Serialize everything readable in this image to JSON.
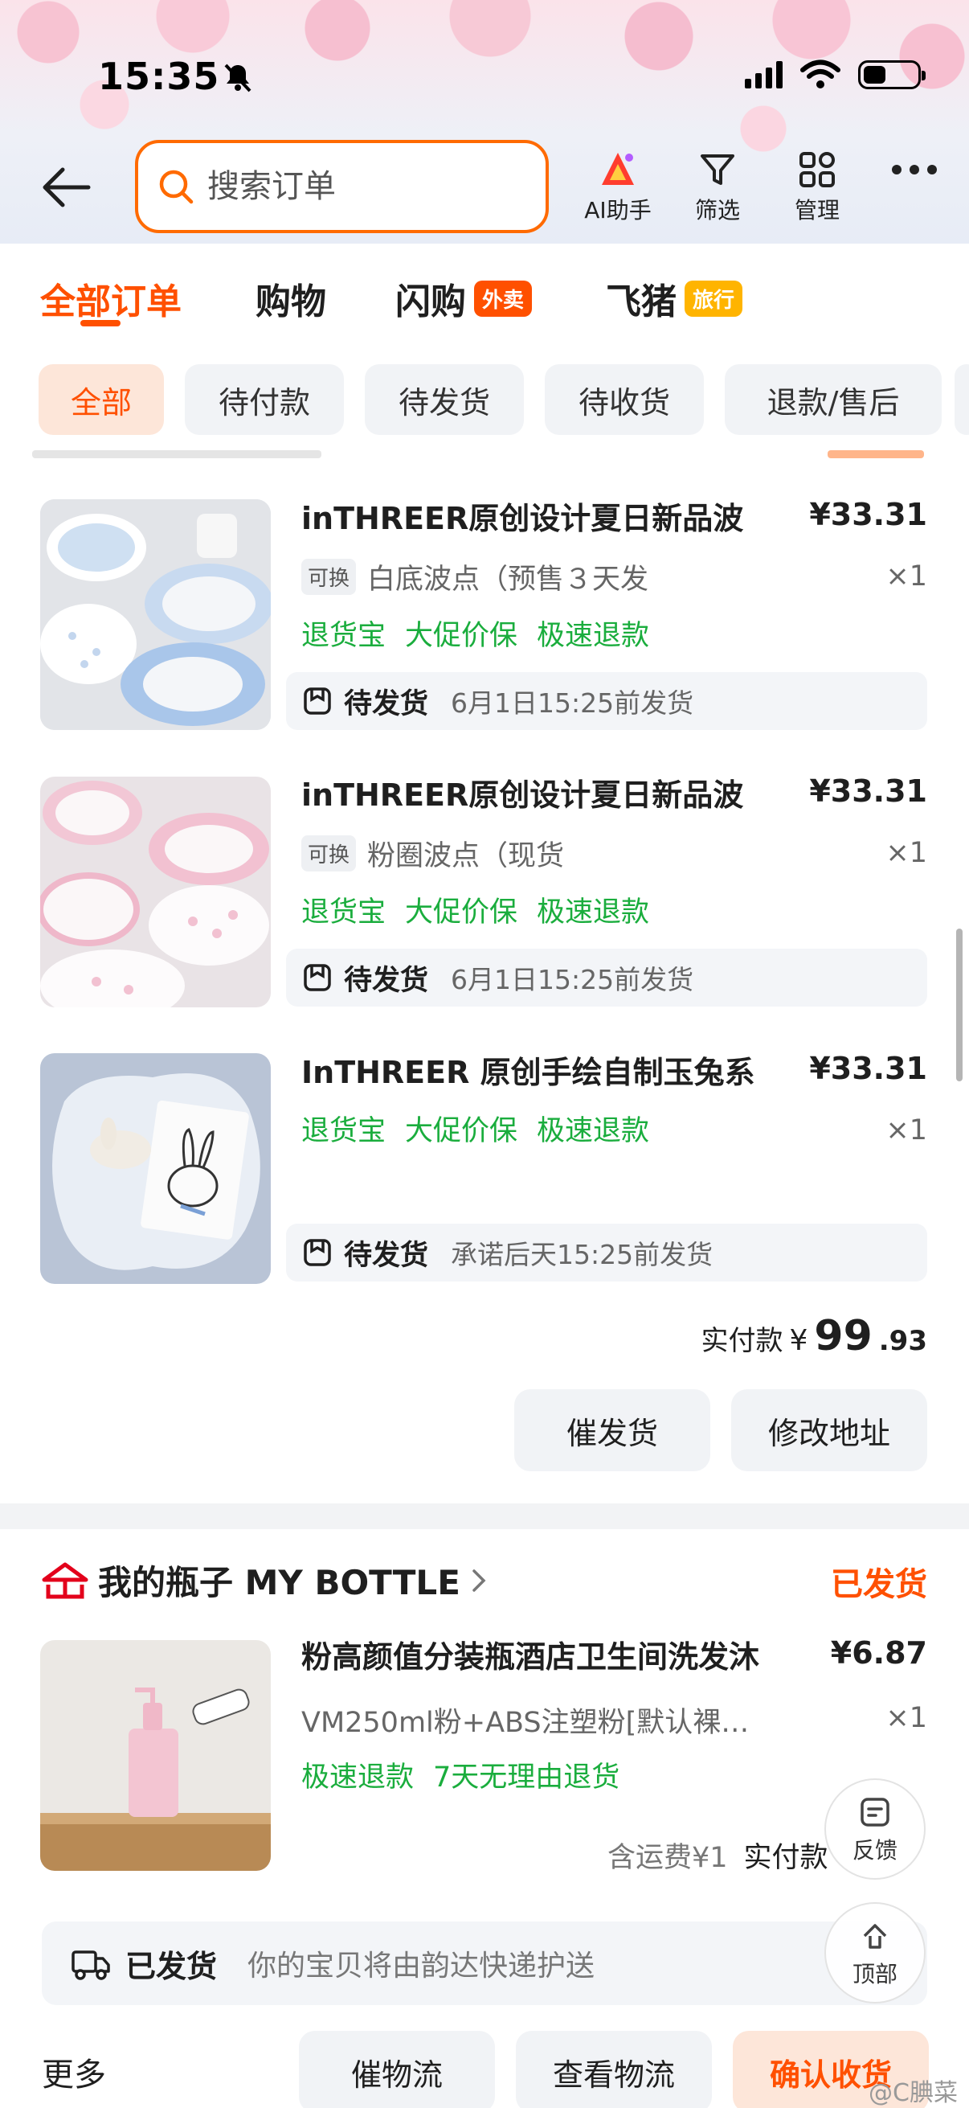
{
  "status_bar": {
    "time": "15:35"
  },
  "header": {
    "search_placeholder": "搜索订单",
    "tools": [
      {
        "label": "AI助手",
        "icon": "ai-assistant-icon"
      },
      {
        "label": "筛选",
        "icon": "filter-icon"
      },
      {
        "label": "管理",
        "icon": "grid-icon"
      }
    ]
  },
  "tabs": [
    {
      "label": "全部订单",
      "active": true
    },
    {
      "label": "购物"
    },
    {
      "label": "闪购",
      "badge": "外卖",
      "badge_color": "#ff5000"
    },
    {
      "label": "飞猪",
      "badge": "旅行",
      "badge_color": "#ffb400"
    }
  ],
  "filters": [
    "全部",
    "待付款",
    "待发货",
    "待收货",
    "退款/售后"
  ],
  "order1": {
    "items": [
      {
        "title": "inTHREER原创设计夏日新品波",
        "price": "¥33.31",
        "swap": "可换",
        "sku": "白底波点（预售３天发",
        "qty": "×1",
        "tags": [
          "退货宝",
          "大促价保",
          "极速退款"
        ],
        "ship_status": "待发货",
        "ship_time": "6月1日15:25前发货"
      },
      {
        "title": "inTHREER原创设计夏日新品波",
        "price": "¥33.31",
        "swap": "可换",
        "sku": "粉圈波点（现货",
        "qty": "×1",
        "tags": [
          "退货宝",
          "大促价保",
          "极速退款"
        ],
        "ship_status": "待发货",
        "ship_time": "6月1日15:25前发货"
      },
      {
        "title": "InTHREER 原创手绘自制玉兔系",
        "price": "¥33.31",
        "qty": "×1",
        "tags": [
          "退货宝",
          "大促价保",
          "极速退款"
        ],
        "ship_status": "待发货",
        "ship_time": "承诺后天15:25前发货"
      }
    ],
    "paid_label": "实付款",
    "paid_currency": "¥",
    "paid_int": "99",
    "paid_dec": ".93",
    "buttons": [
      "催发货",
      "修改地址"
    ]
  },
  "order2": {
    "shop": "我的瓶子 MY BOTTLE",
    "status": "已发货",
    "item": {
      "title": "粉高颜值分装瓶酒店卫生间洗发沐",
      "price": "¥6.87",
      "sku": "VM250ml粉+ABS注塑粉[默认裸…",
      "qty": "×1",
      "tags": [
        "极速退款",
        "7天无理由退货"
      ]
    },
    "fee_note": "含运费¥1",
    "paid_label": "实付款",
    "logistics_status": "已发货",
    "logistics_msg": "你的宝贝将由韵达快递护送",
    "more": "更多",
    "buttons": [
      "催物流",
      "查看物流",
      "确认收货"
    ]
  },
  "floating": {
    "feedback": "反馈",
    "top": "顶部"
  },
  "watermark": "@C腆菜",
  "colors": {
    "accent": "#ff5000",
    "green": "#1aad3d"
  }
}
